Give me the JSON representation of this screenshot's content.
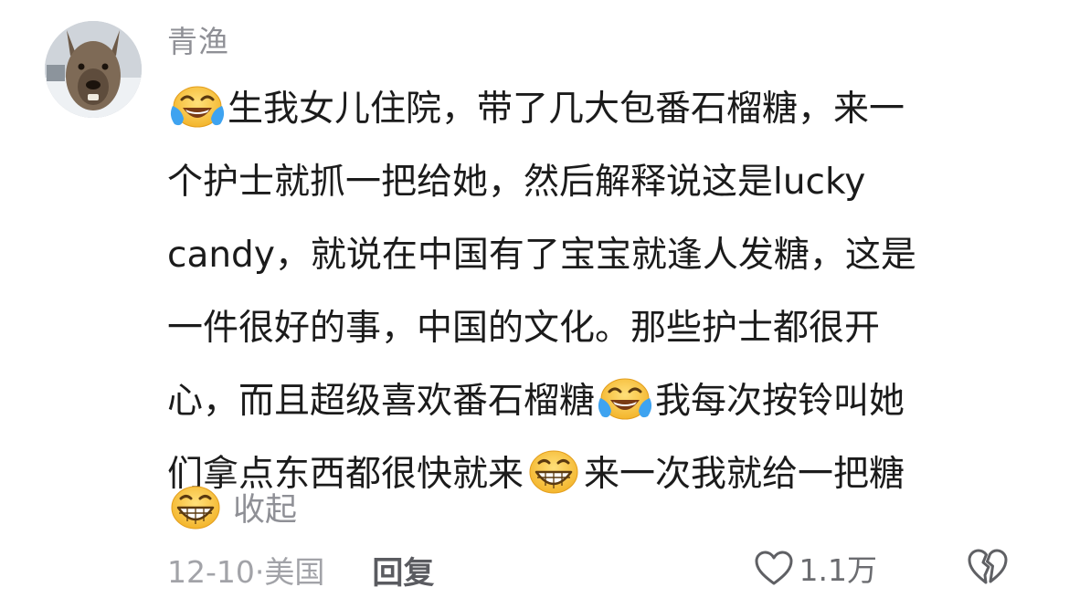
{
  "comment": {
    "username": "青渔",
    "content_lines": [
      {
        "emoji": "tears-of-joy",
        "text": "生我女儿住院，带了几大包番石榴糖，来一"
      },
      {
        "text": "个护士就抓一把给她，然后解释说这是lucky"
      },
      {
        "text": "candy，就说在中国有了宝宝就逢人发糖，这是"
      },
      {
        "text": "一件很好的事，中国的文化。那些护士都很开"
      },
      {
        "text_a": "心，而且超级喜欢番石榴糖",
        "emoji": "tears-of-joy",
        "text_b": "我每次按铃叫她"
      },
      {
        "text_a": "们拿点东西都很快就来",
        "emoji": "grinning-teeth",
        "text_b": "来一次我就给一把糖"
      }
    ],
    "collapse_emoji": "grinning-teeth",
    "collapse_label": "收起",
    "date": "12-10",
    "location": "美国",
    "meta_separator": "·",
    "reply_label": "回复",
    "like_count": "1.1万",
    "icons": {
      "like": "heart-outline-icon",
      "dislike": "broken-heart-icon"
    },
    "colors": {
      "text": "#1b1b1b",
      "muted": "#8f9096",
      "emoji_yellow": "#f6c43c",
      "tear_blue": "#3ea3f0"
    }
  }
}
